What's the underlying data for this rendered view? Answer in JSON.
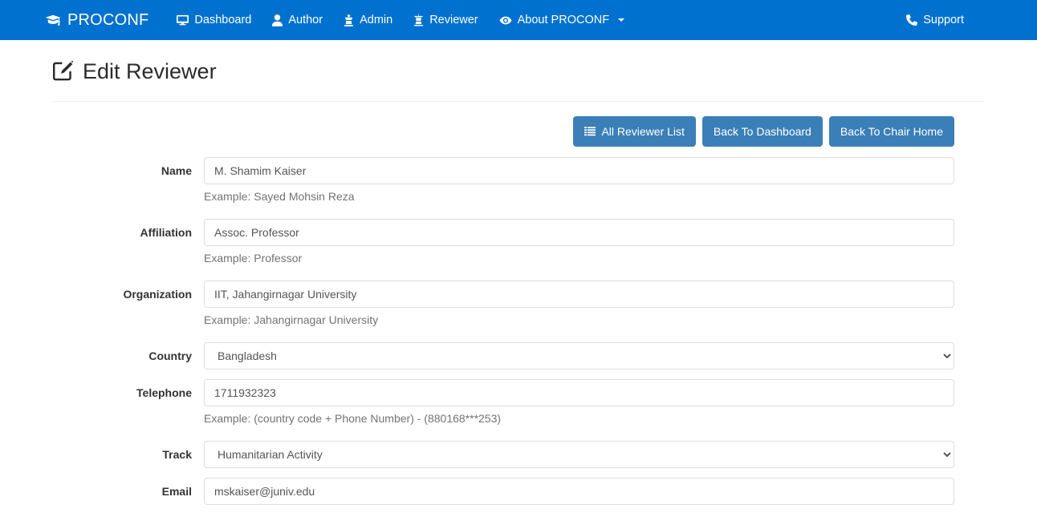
{
  "navbar": {
    "brand": "PROCONF",
    "brand_icon": "graduation-cap-icon",
    "bg_color": "#0071ce",
    "items": [
      {
        "label": "Dashboard",
        "icon": "desktop-icon"
      },
      {
        "label": "Author",
        "icon": "user-icon"
      },
      {
        "label": "Admin",
        "icon": "chess-king-icon"
      },
      {
        "label": "Reviewer",
        "icon": "chess-rook-icon"
      },
      {
        "label": "About PROCONF",
        "icon": "eye-icon",
        "has_caret": true
      }
    ],
    "right": {
      "label": "Support",
      "icon": "phone-icon"
    }
  },
  "page": {
    "title": "Edit Reviewer",
    "title_icon": "edit-square-icon"
  },
  "toolbar": {
    "button_color": "#3b7fb8",
    "buttons": [
      {
        "label": "All Reviewer List",
        "icon": "list-icon"
      },
      {
        "label": "Back To Dashboard",
        "icon": null
      },
      {
        "label": "Back To Chair Home",
        "icon": null
      }
    ]
  },
  "form": {
    "fields": [
      {
        "label": "Name",
        "type": "text",
        "value": "M. Shamim Kaiser",
        "placeholder": "Name",
        "help": "Example: Sayed Mohsin Reza"
      },
      {
        "label": "Affiliation",
        "type": "text",
        "value": "Assoc. Professor",
        "placeholder": "Affiliation",
        "help": "Example: Professor"
      },
      {
        "label": "Organization",
        "type": "text",
        "value": "IIT, Jahangirnagar University",
        "placeholder": "Organization",
        "help": "Example: Jahangirnagar University"
      },
      {
        "label": "Country",
        "type": "select",
        "value": "Bangladesh",
        "help": null
      },
      {
        "label": "Telephone",
        "type": "text",
        "value": "1711932323",
        "placeholder": "Telephone",
        "help": "Example: (country code + Phone Number) - (880168***253)"
      },
      {
        "label": "Track",
        "type": "select",
        "value": "Humanitarian Activity",
        "help": null
      },
      {
        "label": "Email",
        "type": "text",
        "value": "mskaiser@juniv.edu",
        "placeholder": "Email",
        "help": null
      }
    ]
  }
}
